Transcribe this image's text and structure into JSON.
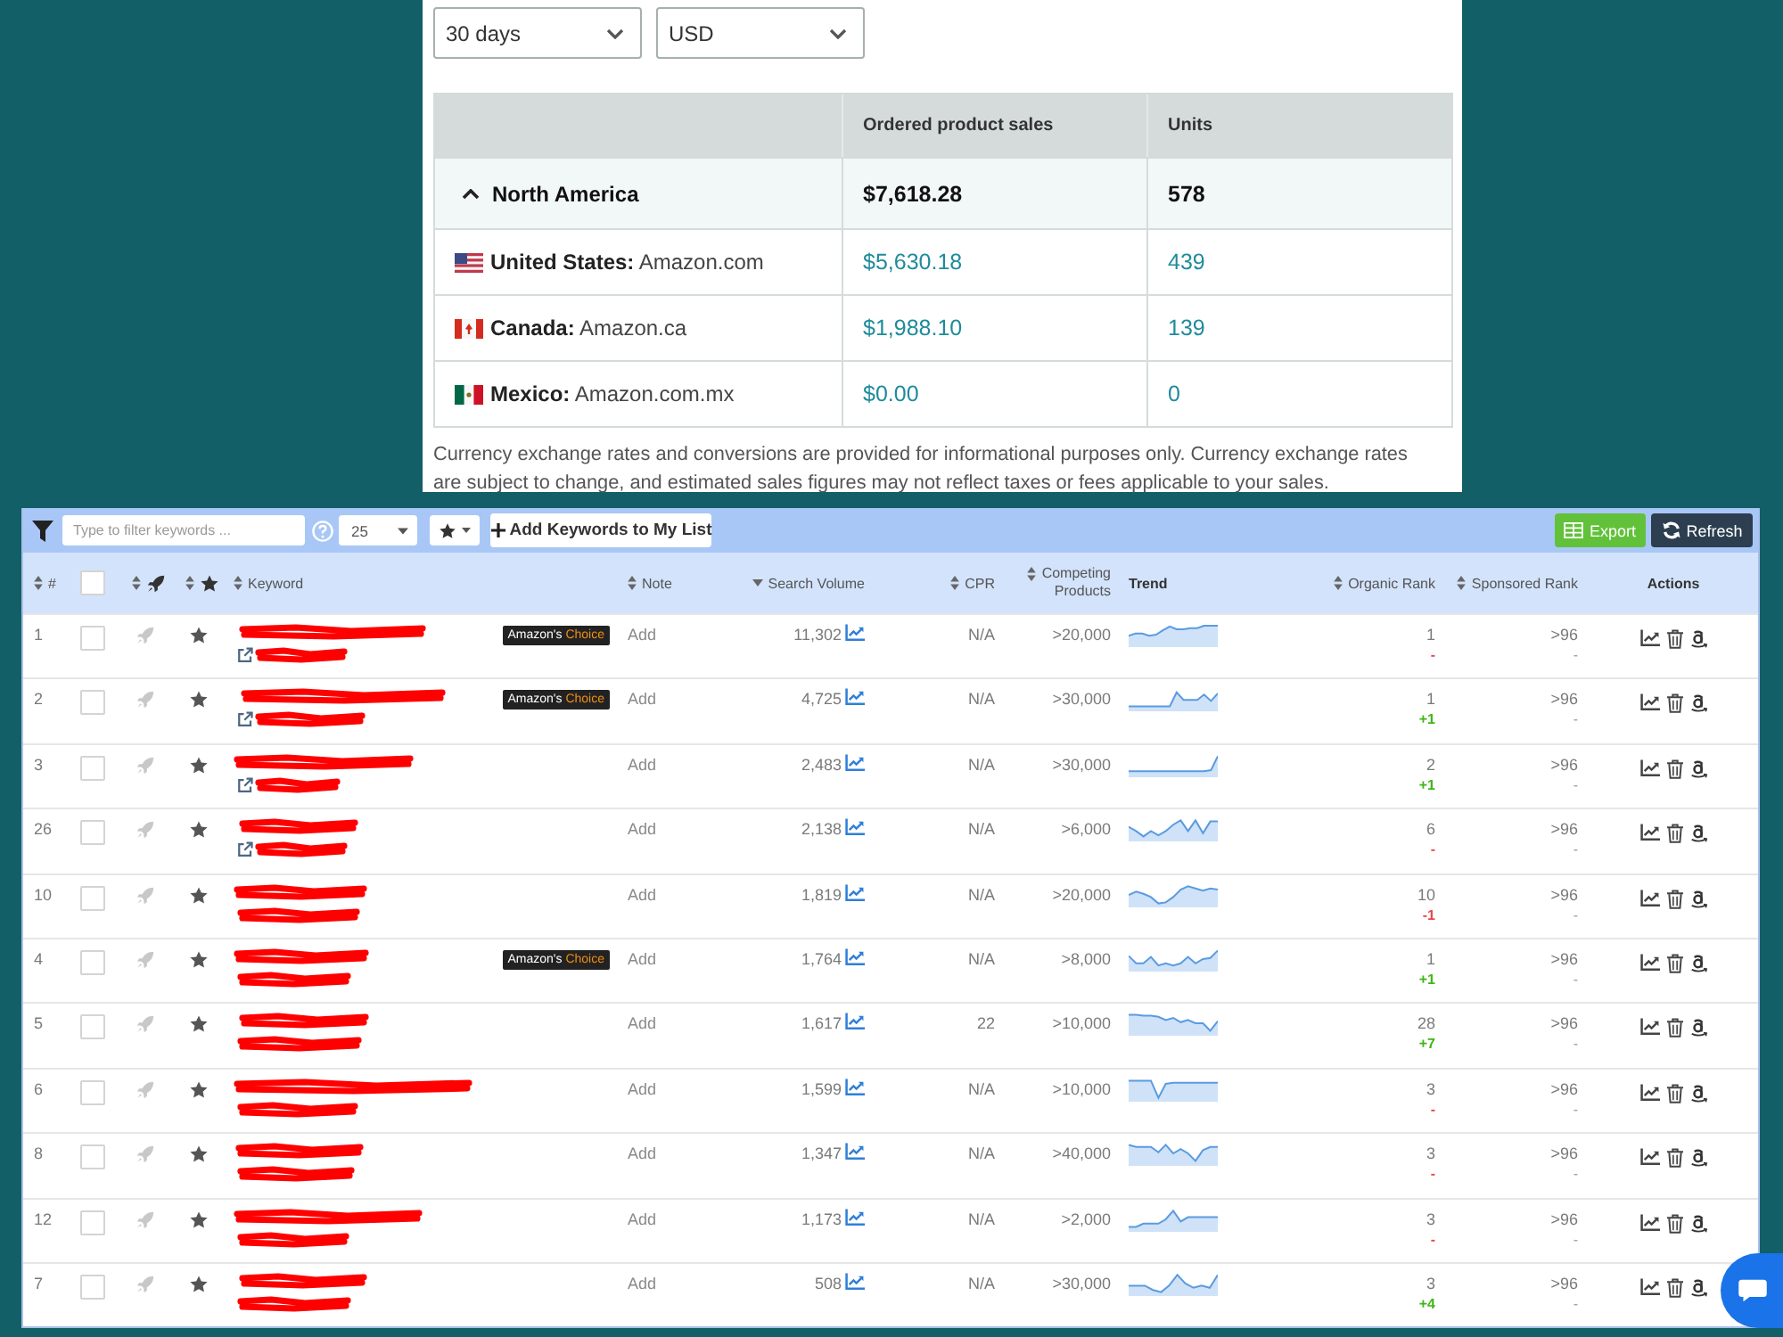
{
  "selects": [
    {
      "value": "30 days"
    },
    {
      "value": "USD"
    }
  ],
  "sales": {
    "columns": [
      "Ordered product sales",
      "Units"
    ],
    "region": {
      "name": "North America",
      "expanded": true,
      "sales": "$7,618.28",
      "units": "578"
    },
    "marketplaces": [
      {
        "kind": "us",
        "name": "**United States:** Amazon.com",
        "sales": "$5,630.18",
        "units": "439"
      },
      {
        "kind": "ca",
        "name": "**Canada:** Amazon.ca",
        "sales": "$1,988.10",
        "units": "139"
      },
      {
        "kind": "mx",
        "name": "**Mexico:** Amazon.com.mx",
        "sales": "$0.00",
        "units": "0"
      }
    ],
    "disclaimer": "Currency exchange rates and conversions are provided for informational purposes only. Currency exchange rates are subject to change, and estimated sales figures may not reflect taxes or fees applicable to your sales."
  },
  "toolbar": {
    "filter_placeholder": "Type to filter keywords ...",
    "page_size": "25",
    "add_button": "Add Keywords to My List",
    "export_button": "Export",
    "refresh_button": "Refresh"
  },
  "table": {
    "columns": [
      {
        "kind": "text",
        "label": "#",
        "sortable": true,
        "sorted": false
      },
      {
        "kind": "checkbox",
        "checked": false
      },
      {
        "kind": "icon",
        "sortable": true,
        "sorted": false
      },
      {
        "kind": "icon",
        "sortable": true,
        "sorted": false
      },
      {
        "kind": "text",
        "label": "Keyword",
        "sortable": true,
        "sorted": false
      },
      {
        "kind": "text",
        "label": "Note",
        "sortable": true,
        "sorted": false
      },
      {
        "kind": "text",
        "label": "Search Volume",
        "sortable": true,
        "sorted": true
      },
      {
        "kind": "text",
        "label": "CPR",
        "sortable": true,
        "sorted": false
      },
      {
        "kind": "text",
        "label": "Competing Products",
        "sortable": true,
        "sorted": false
      },
      {
        "kind": "text",
        "label": "Trend",
        "sortable": false
      },
      {
        "kind": "text",
        "label": "Organic Rank",
        "sortable": true,
        "sorted": false
      },
      {
        "kind": "text",
        "label": "Sponsored Rank",
        "sortable": true,
        "sorted": false
      },
      {
        "kind": "text",
        "label": "Actions",
        "sortable": false
      }
    ],
    "rows": [
      {
        "number": "1",
        "checked": false,
        "redacted": true,
        "external_link": true,
        "badge": {
          "label": "Amazon's",
          "highlight": "Choice"
        },
        "note": "Add",
        "search_volume": "11,302",
        "cpr": "N/A",
        "competing_products": ">20,000",
        "organic_rank": "1",
        "organic_change": {
          "text": "-",
          "color": "#e8474c"
        },
        "sponsored_rank": ">96",
        "sponsored_change": "-"
      },
      {
        "number": "2",
        "checked": false,
        "redacted": true,
        "external_link": true,
        "badge": {
          "label": "Amazon's",
          "highlight": "Choice"
        },
        "note": "Add",
        "search_volume": "4,725",
        "cpr": "N/A",
        "competing_products": ">30,000",
        "organic_rank": "1",
        "organic_change": {
          "text": "+1",
          "color": "#3fb618"
        },
        "sponsored_rank": ">96",
        "sponsored_change": "-"
      },
      {
        "number": "3",
        "checked": false,
        "redacted": true,
        "external_link": true,
        "note": "Add",
        "search_volume": "2,483",
        "cpr": "N/A",
        "competing_products": ">30,000",
        "organic_rank": "2",
        "organic_change": {
          "text": "+1",
          "color": "#3fb618"
        },
        "sponsored_rank": ">96",
        "sponsored_change": "-"
      },
      {
        "number": "26",
        "checked": false,
        "redacted": true,
        "external_link": true,
        "note": "Add",
        "search_volume": "2,138",
        "cpr": "N/A",
        "competing_products": ">6,000",
        "organic_rank": "6",
        "organic_change": {
          "text": "-",
          "color": "#e8474c"
        },
        "sponsored_rank": ">96",
        "sponsored_change": "-"
      },
      {
        "number": "10",
        "checked": false,
        "redacted": true,
        "external_link": false,
        "note": "Add",
        "search_volume": "1,819",
        "cpr": "N/A",
        "competing_products": ">20,000",
        "organic_rank": "10",
        "organic_change": {
          "text": "-1",
          "color": "#e8474c"
        },
        "sponsored_rank": ">96",
        "sponsored_change": "-"
      },
      {
        "number": "4",
        "checked": false,
        "redacted": true,
        "external_link": false,
        "badge": {
          "label": "Amazon's",
          "highlight": "Choice"
        },
        "note": "Add",
        "search_volume": "1,764",
        "cpr": "N/A",
        "competing_products": ">8,000",
        "organic_rank": "1",
        "organic_change": {
          "text": "+1",
          "color": "#3fb618"
        },
        "sponsored_rank": ">96",
        "sponsored_change": "-"
      },
      {
        "number": "5",
        "checked": false,
        "redacted": true,
        "external_link": false,
        "note": "Add",
        "search_volume": "1,617",
        "cpr": "22",
        "competing_products": ">10,000",
        "organic_rank": "28",
        "organic_change": {
          "text": "+7",
          "color": "#3fb618"
        },
        "sponsored_rank": ">96",
        "sponsored_change": "-"
      },
      {
        "number": "6",
        "checked": false,
        "redacted": true,
        "external_link": false,
        "note": "Add",
        "search_volume": "1,599",
        "cpr": "N/A",
        "competing_products": ">10,000",
        "organic_rank": "3",
        "organic_change": {
          "text": "-",
          "color": "#e8474c"
        },
        "sponsored_rank": ">96",
        "sponsored_change": "-"
      },
      {
        "number": "8",
        "checked": false,
        "redacted": true,
        "external_link": false,
        "note": "Add",
        "search_volume": "1,347",
        "cpr": "N/A",
        "competing_products": ">40,000",
        "organic_rank": "3",
        "organic_change": {
          "text": "-",
          "color": "#e8474c"
        },
        "sponsored_rank": ">96",
        "sponsored_change": "-"
      },
      {
        "number": "12",
        "checked": false,
        "redacted": true,
        "external_link": false,
        "note": "Add",
        "search_volume": "1,173",
        "cpr": "N/A",
        "competing_products": ">2,000",
        "organic_rank": "3",
        "organic_change": {
          "text": "-",
          "color": "#e8474c"
        },
        "sponsored_rank": ">96",
        "sponsored_change": "-"
      },
      {
        "number": "7",
        "checked": false,
        "redacted": true,
        "external_link": false,
        "note": "Add",
        "search_volume": "508",
        "cpr": "N/A",
        "competing_products": ">30,000",
        "organic_rank": "3",
        "organic_change": {
          "text": "+4",
          "color": "#3fb618"
        },
        "sponsored_rank": ">96",
        "sponsored_change": "-"
      }
    ]
  }
}
